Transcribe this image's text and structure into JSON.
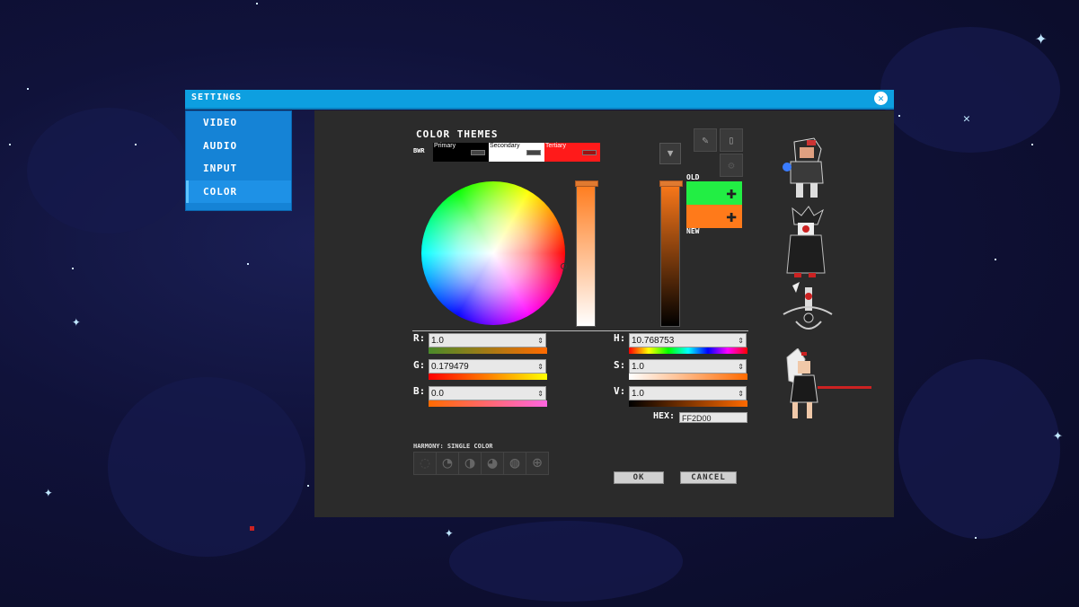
{
  "window": {
    "title": "SETTINGS"
  },
  "sidebar": {
    "items": [
      {
        "label": "VIDEO",
        "active": false
      },
      {
        "label": "AUDIO",
        "active": false
      },
      {
        "label": "INPUT",
        "active": false
      },
      {
        "label": "COLOR",
        "active": true
      }
    ]
  },
  "themes": {
    "title": "COLOR THEMES",
    "preset": "BWR",
    "swatches": [
      {
        "label": "Primary",
        "color": "#000000"
      },
      {
        "label": "Secondary",
        "color": "#ffffff"
      },
      {
        "label": "Tertiary",
        "color": "#ff1a1a"
      }
    ]
  },
  "preview": {
    "old_label": "OLD",
    "new_label": "NEW",
    "old_color": "#22ee44",
    "new_color": "#ff7a1a"
  },
  "fields": {
    "r": {
      "label": "R:",
      "value": "1.0"
    },
    "g": {
      "label": "G:",
      "value": "0.179479"
    },
    "b": {
      "label": "B:",
      "value": "0.0"
    },
    "h": {
      "label": "H:",
      "value": "10.768753"
    },
    "s": {
      "label": "S:",
      "value": "1.0"
    },
    "v": {
      "label": "V:",
      "value": "1.0"
    },
    "hex_label": "HEX:",
    "hex_value": "FF2D00"
  },
  "harmony": {
    "label": "HARMONY: SINGLE COLOR"
  },
  "buttons": {
    "ok": "OK",
    "cancel": "CANCEL"
  },
  "icons": [
    "close-icon",
    "chevron-down-icon",
    "pencil-icon",
    "document-icon",
    "gear-icon",
    "plus-icon"
  ]
}
